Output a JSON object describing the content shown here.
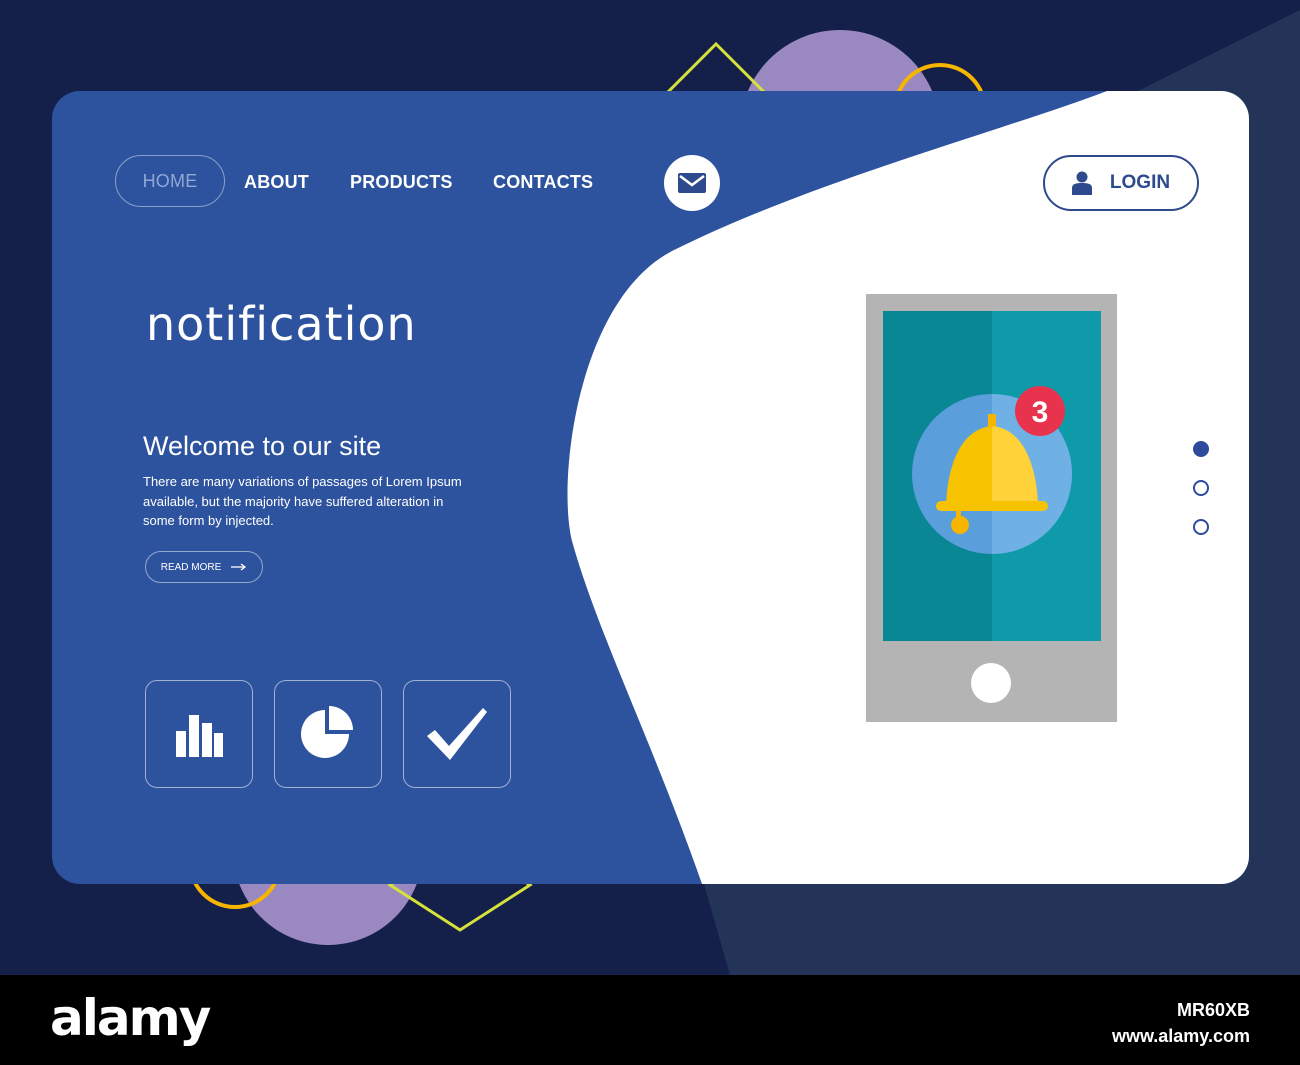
{
  "nav": {
    "home": "HOME",
    "about": "ABOUT",
    "products": "PRODUCTS",
    "contacts": "CONTACTS",
    "login": "LOGIN"
  },
  "hero": {
    "title": "notification",
    "welcome": "Welcome to our site",
    "description": "There are many variations of passages of Lorem Ipsum available, but the majority have suffered alteration in some form by injected.",
    "read_more": "READ MORE"
  },
  "features": [
    {
      "icon": "bar-chart-icon"
    },
    {
      "icon": "pie-chart-icon"
    },
    {
      "icon": "checkmark-icon"
    }
  ],
  "phone": {
    "badge_count": "3",
    "icon": "bell-icon"
  },
  "pager": {
    "total": 3,
    "active": 1
  },
  "watermark": {
    "brand": "alamy",
    "image_id": "MR60XB",
    "url": "www.alamy.com"
  },
  "colors": {
    "background": "#15204a",
    "card_blue": "#2d529e",
    "white": "#ffffff",
    "accent_yellow": "#f7b500",
    "badge_red": "#e8334f",
    "phone_teal": "#0f9aa9"
  }
}
